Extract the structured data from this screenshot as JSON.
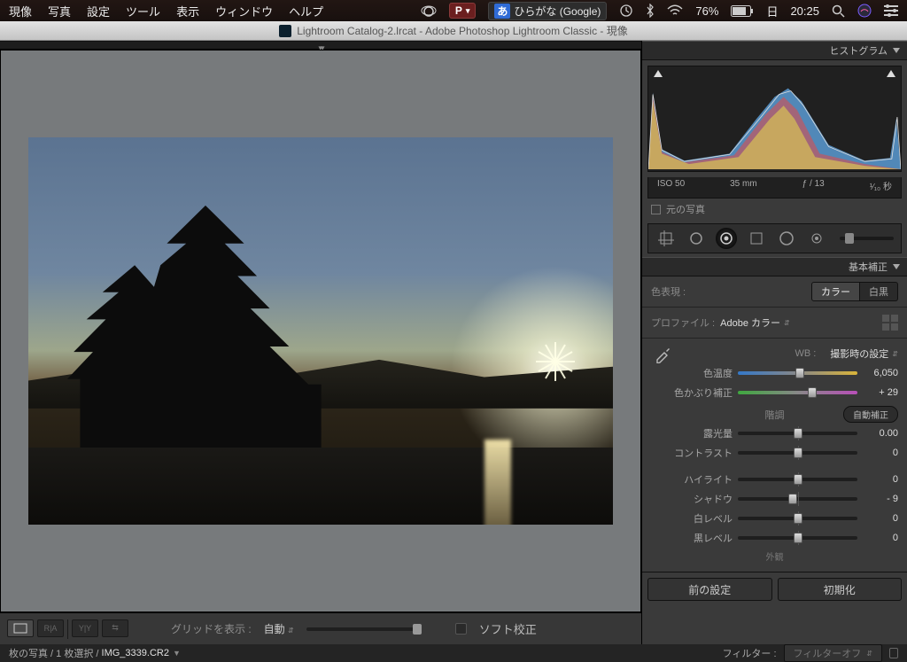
{
  "mac_menu": {
    "items": [
      "現像",
      "写真",
      "設定",
      "ツール",
      "表示",
      "ウィンドウ",
      "ヘルプ"
    ],
    "ime_label": "ひらがな (Google)",
    "ime_badge": "あ",
    "battery": "76%",
    "clock_day": "日",
    "clock_time": "20:25"
  },
  "titlebar": {
    "text": "Lightroom Catalog-2.lrcat - Adobe Photoshop Lightroom Classic - 現像"
  },
  "histogram": {
    "title": "ヒストグラム",
    "iso": "ISO 50",
    "focal": "35 mm",
    "aperture": "ƒ / 13",
    "shutter_pre": "¹⁄₁₀",
    "shutter_unit": "秒",
    "original_label": "元の写真"
  },
  "basic": {
    "title": "基本補正",
    "treatment_label": "色表現 :",
    "treatment_color": "カラー",
    "treatment_bw": "白黒",
    "profile_label": "プロファイル :",
    "profile_value": "Adobe カラー",
    "wb_label": "WB :",
    "wb_value": "撮影時の設定",
    "temp_label": "色温度",
    "temp_value": "6,050",
    "tint_label": "色かぶり補正",
    "tint_value": "+ 29",
    "tone_title": "階調",
    "auto_label": "自動補正",
    "exposure_label": "露光量",
    "exposure_value": "0.00",
    "contrast_label": "コントラスト",
    "contrast_value": "0",
    "highlights_label": "ハイライト",
    "highlights_value": "0",
    "shadows_label": "シャドウ",
    "shadows_value": "- 9",
    "whites_label": "白レベル",
    "whites_value": "0",
    "blacks_label": "黒レベル",
    "blacks_value": "0",
    "presence_title": "外観"
  },
  "actions": {
    "previous": "前の設定",
    "reset": "初期化"
  },
  "toolbar": {
    "grid_label": "グリッドを表示 :",
    "grid_mode": "自動",
    "softproof": "ソフト校正"
  },
  "status": {
    "selection": "枚の写真 / 1 枚選択 /",
    "filename": "IMG_3339.CR2",
    "filter_label": "フィルター :",
    "filter_value": "フィルターオフ"
  },
  "slider_positions": {
    "temp": 52,
    "tint": 62,
    "exposure": 50,
    "contrast": 50,
    "highlights": 50,
    "shadows": 46,
    "whites": 50,
    "blacks": 50
  }
}
